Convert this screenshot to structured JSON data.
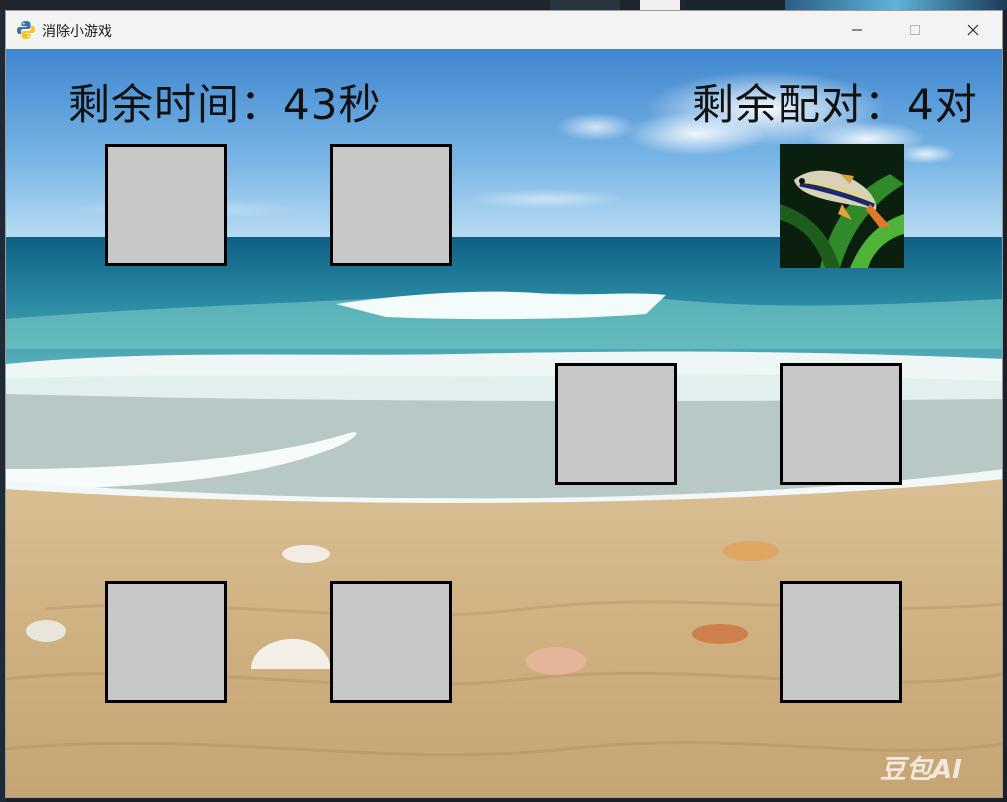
{
  "window": {
    "title": "消除小游戏",
    "app_icon": "python-icon",
    "buttons": {
      "minimize": "minimize-icon",
      "maximize": "maximize-icon",
      "close": "close-icon"
    }
  },
  "hud": {
    "time_label": "剩余时间：",
    "time_value": "43秒",
    "pairs_label": "剩余配对：",
    "pairs_value": "4对"
  },
  "board": {
    "rows": [
      [
        {
          "state": "hidden"
        },
        {
          "state": "hidden"
        },
        {
          "state": "empty"
        },
        {
          "state": "revealed",
          "image": "fish-image"
        }
      ],
      [
        {
          "state": "empty"
        },
        {
          "state": "empty"
        },
        {
          "state": "hidden"
        },
        {
          "state": "hidden"
        }
      ],
      [
        {
          "state": "hidden"
        },
        {
          "state": "hidden"
        },
        {
          "state": "empty"
        },
        {
          "state": "hidden"
        }
      ]
    ]
  },
  "background": "beach-scene",
  "watermark": "豆包AI",
  "colors": {
    "tile_face": "#c8c8c8",
    "tile_border": "#000000",
    "hud_text": "#111111"
  }
}
